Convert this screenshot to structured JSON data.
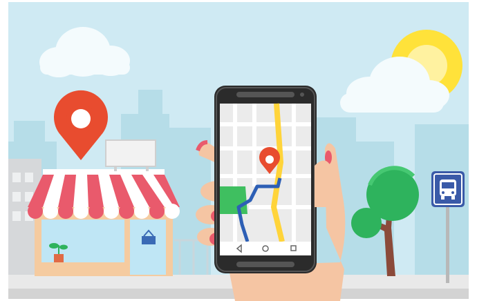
{
  "illustration": {
    "subject": "",
    "elements": [
      "storefront",
      "location-pin",
      "smartphone-map",
      "hand",
      "tree",
      "bus-stop-sign",
      "sun",
      "clouds",
      "city-skyline"
    ]
  },
  "colors": {
    "sky": "#cfeaf3",
    "skyline": "#b6dde8",
    "pin_red": "#e84c2f",
    "awning_red": "#e95a6c",
    "awning_white": "#ffffff",
    "shop_wall": "#bfe6f5",
    "shop_frame": "#f5cba0",
    "sun": "#ffe23a",
    "tree_green": "#2eb35d",
    "trunk": "#8b4a3a",
    "bus_sign": "#3a5aa8",
    "road": "#d9d9d9",
    "skin": "#f5c5a3",
    "phone_body": "#2b2b2b",
    "map_bg": "#ebebeb",
    "map_route": "#2d5fb5",
    "map_highway": "#ffd43a",
    "map_park": "#3fbf60"
  }
}
